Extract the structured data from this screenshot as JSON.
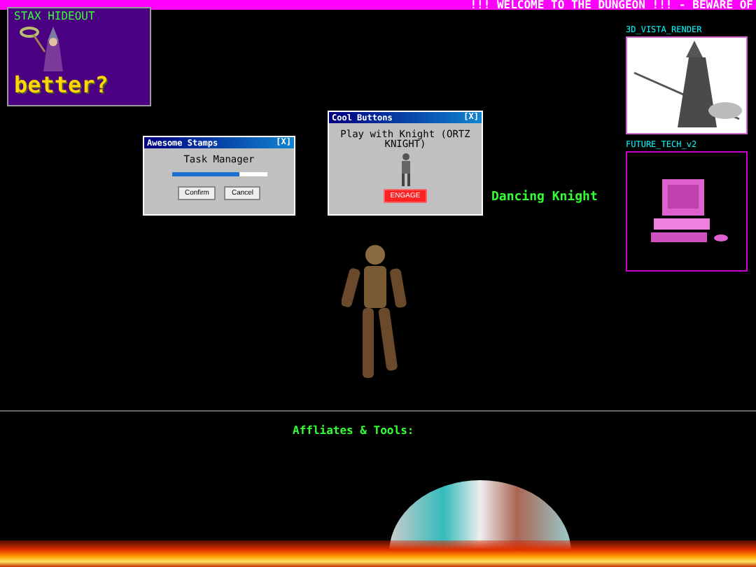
{
  "marquee": "!!! WELCOME TO THE DUNGEON !!! - BEWARE OF",
  "stax_box": {
    "title": "STAX HIDEOUT",
    "caption": "better?"
  },
  "dialogs": [
    {
      "kind": "progress",
      "title": "Awesome Stamps",
      "close": "[X]",
      "label": "Task Manager",
      "level": 0.72,
      "buttons": [
        "Confirm",
        "Cancel"
      ]
    },
    {
      "kind": "action",
      "title": "Cool Buttons",
      "close": "[X]",
      "label": "Play with Knight (ORTZ KNIGHT)",
      "buttons": [
        "ENGAGE"
      ]
    }
  ],
  "dancing_label": "Dancing Knight",
  "side_images": [
    {
      "kind": "render",
      "title": "3D_VISTA_RENDER"
    },
    {
      "kind": "computer",
      "title": "FUTURE_TECH_v2"
    }
  ],
  "footer": {
    "heading": "Affliates & Tools:"
  }
}
